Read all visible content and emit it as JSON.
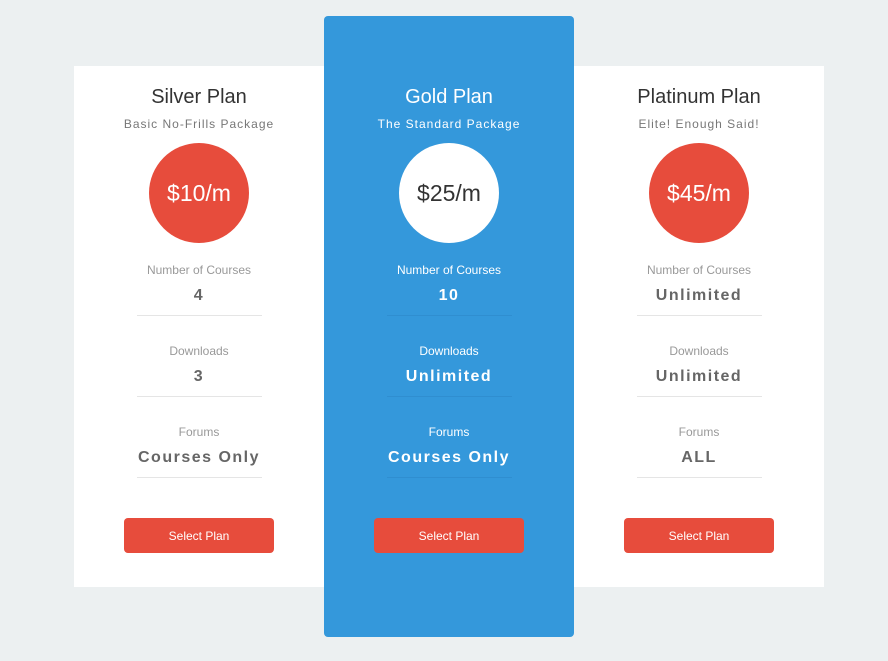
{
  "plans": [
    {
      "title": "Silver Plan",
      "subtitle": "Basic No-Frills Package",
      "price": "$10/m",
      "features": [
        {
          "label": "Number of Courses",
          "value": "4"
        },
        {
          "label": "Downloads",
          "value": "3"
        },
        {
          "label": "Forums",
          "value": "Courses Only"
        }
      ],
      "button_label": "Select Plan"
    },
    {
      "title": "Gold Plan",
      "subtitle": "The Standard Package",
      "price": "$25/m",
      "features": [
        {
          "label": "Number of Courses",
          "value": "10"
        },
        {
          "label": "Downloads",
          "value": "Unlimited"
        },
        {
          "label": "Forums",
          "value": "Courses Only"
        }
      ],
      "button_label": "Select Plan"
    },
    {
      "title": "Platinum Plan",
      "subtitle": "Elite! Enough Said!",
      "price": "$45/m",
      "features": [
        {
          "label": "Number of Courses",
          "value": "Unlimited"
        },
        {
          "label": "Downloads",
          "value": "Unlimited"
        },
        {
          "label": "Forums",
          "value": "ALL"
        }
      ],
      "button_label": "Select Plan"
    }
  ],
  "colors": {
    "accent_red": "#e74c3c",
    "featured_blue": "#3498db",
    "background": "#ecf0f1"
  }
}
